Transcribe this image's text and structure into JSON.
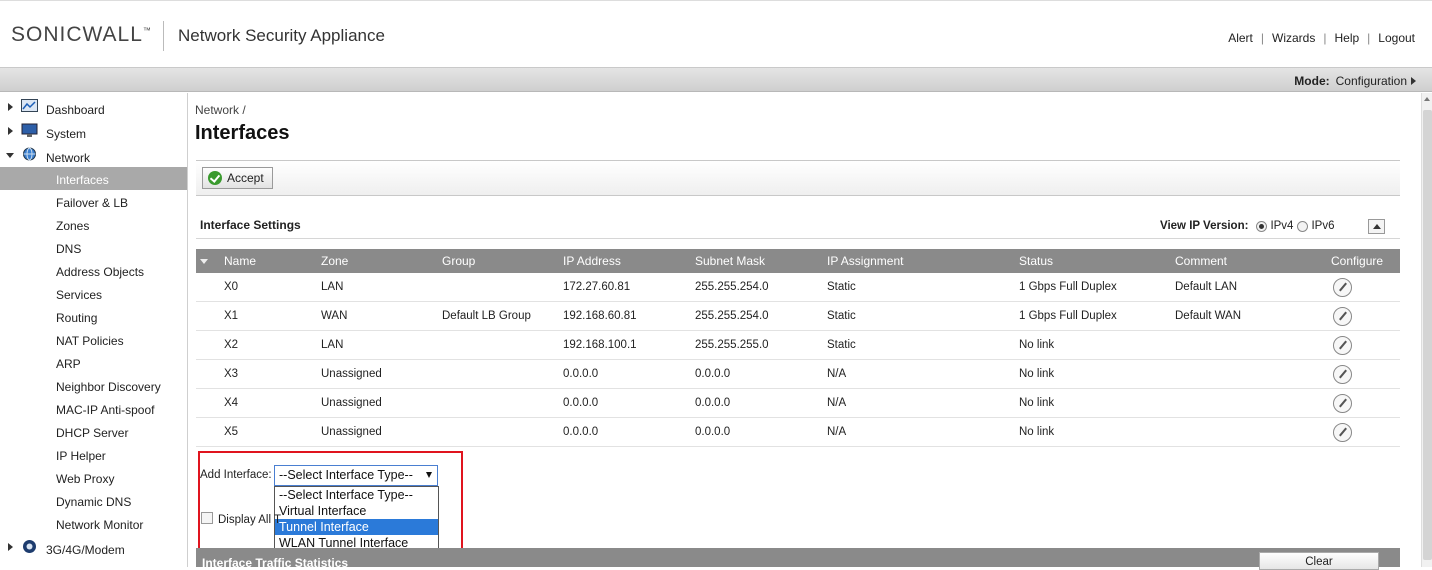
{
  "header": {
    "logo_text": "SONICWALL",
    "logo_mark": "™",
    "product": "Network Security Appliance",
    "links": [
      "Alert",
      "Wizards",
      "Help",
      "Logout"
    ]
  },
  "mode": {
    "label": "Mode:",
    "value": "Configuration"
  },
  "sidebar": {
    "top_items": [
      {
        "label": "Dashboard",
        "icon": "dashboard-icon"
      },
      {
        "label": "System",
        "icon": "monitor-icon"
      },
      {
        "label": "Network",
        "icon": "globe-icon"
      }
    ],
    "network_items": [
      "Interfaces",
      "Failover & LB",
      "Zones",
      "DNS",
      "Address Objects",
      "Services",
      "Routing",
      "NAT Policies",
      "ARP",
      "Neighbor Discovery",
      "MAC-IP Anti-spoof",
      "DHCP Server",
      "IP Helper",
      "Web Proxy",
      "Dynamic DNS",
      "Network Monitor"
    ],
    "active_item": "Interfaces",
    "bottom_item": {
      "label": "3G/4G/Modem",
      "icon": "modem-icon"
    }
  },
  "breadcrumb": "Network /",
  "title": "Interfaces",
  "toolbar": {
    "accept_label": "Accept"
  },
  "interface_settings": {
    "title": "Interface Settings",
    "view_ip_label": "View IP Version:",
    "ipv4_label": "IPv4",
    "ipv6_label": "IPv6",
    "selected_ip_version": "IPv4"
  },
  "table": {
    "columns": [
      "Name",
      "Zone",
      "Group",
      "IP Address",
      "Subnet Mask",
      "IP Assignment",
      "Status",
      "Comment",
      "Configure"
    ],
    "rows": [
      [
        "X0",
        "LAN",
        "",
        "172.27.60.81",
        "255.255.254.0",
        "Static",
        "1 Gbps Full Duplex",
        "Default LAN"
      ],
      [
        "X1",
        "WAN",
        "Default LB Group",
        "192.168.60.81",
        "255.255.254.0",
        "Static",
        "1 Gbps Full Duplex",
        "Default WAN"
      ],
      [
        "X2",
        "LAN",
        "",
        "192.168.100.1",
        "255.255.255.0",
        "Static",
        "No link",
        ""
      ],
      [
        "X3",
        "Unassigned",
        "",
        "0.0.0.0",
        "0.0.0.0",
        "N/A",
        "No link",
        ""
      ],
      [
        "X4",
        "Unassigned",
        "",
        "0.0.0.0",
        "0.0.0.0",
        "N/A",
        "No link",
        ""
      ],
      [
        "X5",
        "Unassigned",
        "",
        "0.0.0.0",
        "0.0.0.0",
        "N/A",
        "No link",
        ""
      ]
    ]
  },
  "add_interface": {
    "label": "Add Interface:",
    "selected": "--Select Interface Type--",
    "options": [
      "--Select Interface Type--",
      "Virtual Interface",
      "Tunnel Interface",
      "WLAN Tunnel Interface"
    ],
    "highlighted": "Tunnel Interface"
  },
  "display_all": {
    "label": "Display All T"
  },
  "stats": {
    "title": "Interface Traffic Statistics",
    "clear_label": "Clear"
  },
  "colors": {
    "highlight": "#2b7ad9",
    "red_box": "#e0141e",
    "table_header": "#8a8a8a"
  }
}
